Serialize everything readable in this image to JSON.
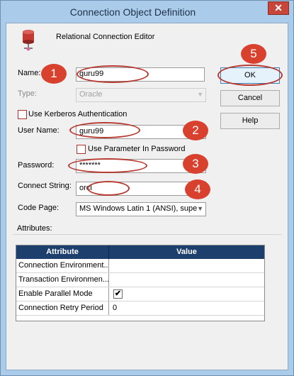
{
  "window": {
    "title": "Connection Object Definition",
    "close": "✕"
  },
  "header": {
    "editor_label": "Relational Connection Editor",
    "icon": "database-icon"
  },
  "form": {
    "name_label": "Name:",
    "name_value": "guru99",
    "type_label": "Type:",
    "type_value": "Oracle",
    "kerberos_label": "Use Kerberos Authentication",
    "kerberos_checked": false,
    "username_label": "User Name:",
    "username_value": "guru99",
    "param_password_label": "Use Parameter In Password",
    "param_password_checked": false,
    "password_label": "Password:",
    "password_value": "*******",
    "connect_label": "Connect String:",
    "connect_value": "orcl",
    "codepage_label": "Code Page:",
    "codepage_value": "MS Windows Latin 1 (ANSI), supe"
  },
  "buttons": {
    "ok": "OK",
    "cancel": "Cancel",
    "help": "Help"
  },
  "callouts": [
    "1",
    "2",
    "3",
    "4",
    "5"
  ],
  "attributes": {
    "heading": "Attributes:",
    "columns": [
      "Attribute",
      "Value"
    ],
    "rows": [
      {
        "attribute": "Connection Environment...",
        "value": ""
      },
      {
        "attribute": "Transaction Environmen...",
        "value": ""
      },
      {
        "attribute": "Enable Parallel Mode",
        "value": "✔"
      },
      {
        "attribute": "Connection Retry Period",
        "value": "0"
      }
    ]
  },
  "colors": {
    "accent": "#1c3f6e",
    "callout": "#d9412f",
    "titlebar": "#aacbea"
  }
}
